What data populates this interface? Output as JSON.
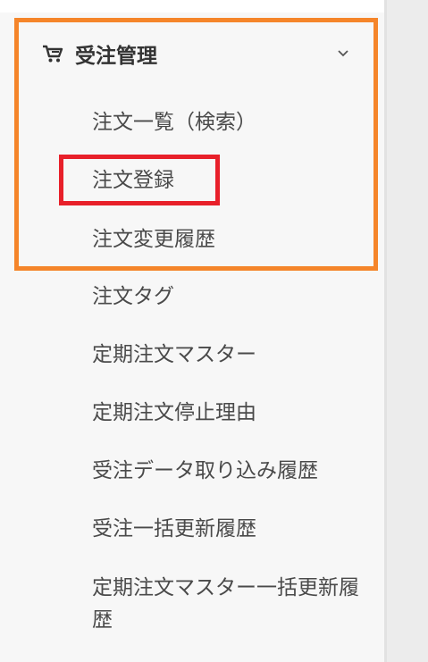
{
  "menu": {
    "title": "受注管理",
    "icon": "cart-icon",
    "chevron": "chevron-down-icon",
    "highlight_color": "#f5852a",
    "active_color": "#e8202a",
    "items": [
      {
        "label": "注文一覧（検索）"
      },
      {
        "label": "注文登録",
        "active": true
      },
      {
        "label": "注文変更履歴"
      },
      {
        "label": "注文タグ"
      },
      {
        "label": "定期注文マスター"
      },
      {
        "label": "定期注文停止理由"
      },
      {
        "label": "受注データ取り込み履歴"
      },
      {
        "label": "受注一括更新履歴"
      },
      {
        "label": "定期注文マスター一括更新履歴"
      }
    ]
  }
}
